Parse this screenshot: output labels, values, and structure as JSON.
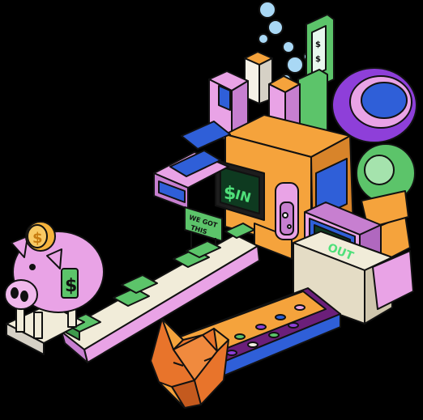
{
  "screen_in": {
    "symbol": "$",
    "text": "IN"
  },
  "screen_out": {
    "text": "OUT"
  },
  "sign": {
    "line1": "WE GOT",
    "line2": "THIS"
  },
  "coin": {
    "symbol": "$"
  },
  "pig": {
    "symbol": "$"
  },
  "colors": {
    "outline": "#111111",
    "pink": "#e9a3e6",
    "purple": "#8e3fd9",
    "orange": "#f5a33c",
    "green": "#5cc46a",
    "screen_green": "#4fe07a",
    "blue": "#2f5fd8",
    "fox": "#e8742b",
    "cream": "#f1ecd9"
  }
}
